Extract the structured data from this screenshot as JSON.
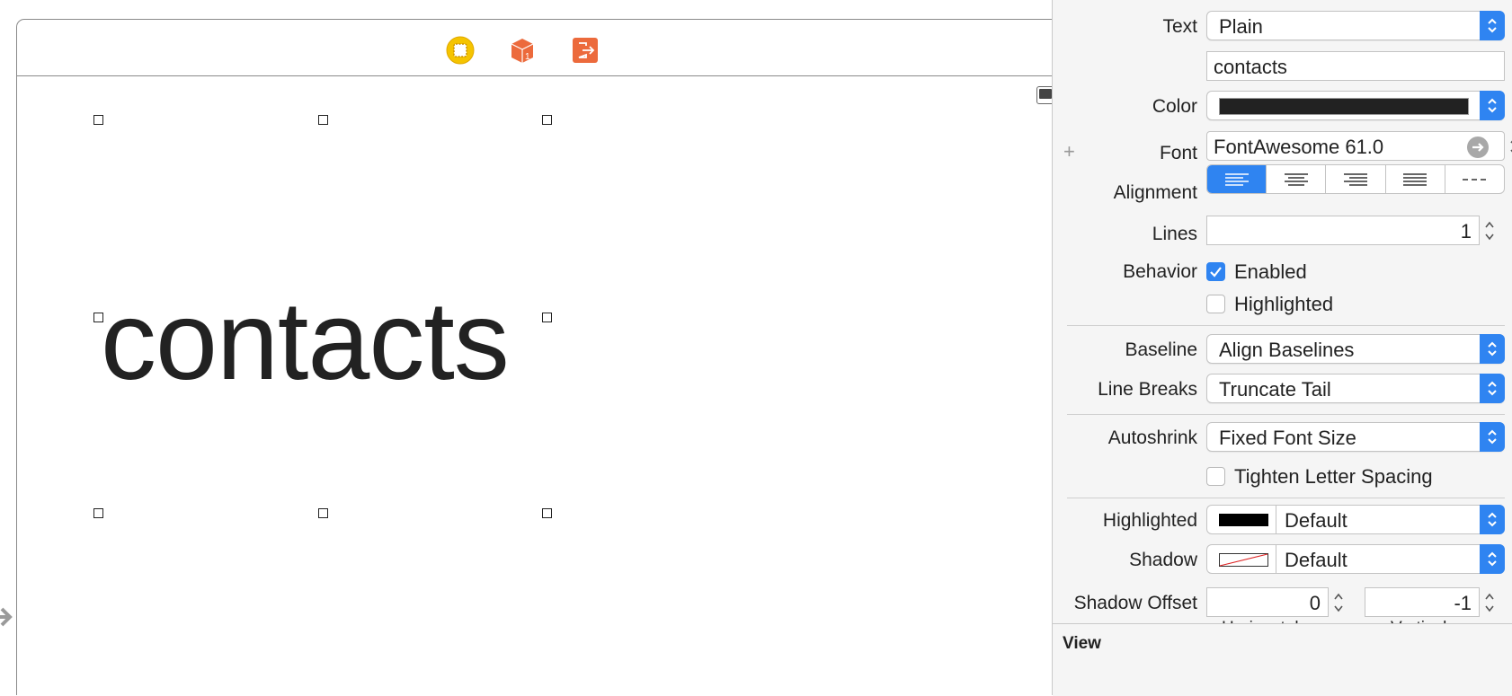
{
  "canvas": {
    "label_text": "contacts",
    "dock_icons": [
      "view-controller-icon",
      "first-responder-icon",
      "exit-icon"
    ]
  },
  "inspector": {
    "text": {
      "label": "Text",
      "value": "Plain"
    },
    "text_content": "contacts",
    "color": {
      "label": "Color",
      "swatch": "#222222"
    },
    "font": {
      "label": "Font",
      "value": "FontAwesome 61.0"
    },
    "alignment": {
      "label": "Alignment",
      "options": [
        "left",
        "center",
        "right",
        "justified",
        "natural"
      ],
      "selected": "left"
    },
    "lines": {
      "label": "Lines",
      "value": "1"
    },
    "behavior": {
      "label": "Behavior",
      "enabled_label": "Enabled",
      "enabled": true,
      "highlighted_label": "Highlighted",
      "highlighted": false
    },
    "baseline": {
      "label": "Baseline",
      "value": "Align Baselines"
    },
    "line_breaks": {
      "label": "Line Breaks",
      "value": "Truncate Tail"
    },
    "autoshrink": {
      "label": "Autoshrink",
      "value": "Fixed Font Size"
    },
    "tighten": {
      "label": "Tighten Letter Spacing",
      "checked": false
    },
    "highlighted_color": {
      "label": "Highlighted",
      "value": "Default",
      "swatch": "#000000"
    },
    "shadow": {
      "label": "Shadow",
      "value": "Default"
    },
    "shadow_offset": {
      "label": "Shadow Offset",
      "horizontal": "0",
      "vertical": "-1",
      "horizontal_label": "Horizontal",
      "vertical_label": "Vertical"
    },
    "section_view": "View"
  },
  "colors": {
    "accent": "#2f84f1",
    "dock_yellow": "#f5c400",
    "dock_orange": "#ec6a3c"
  }
}
